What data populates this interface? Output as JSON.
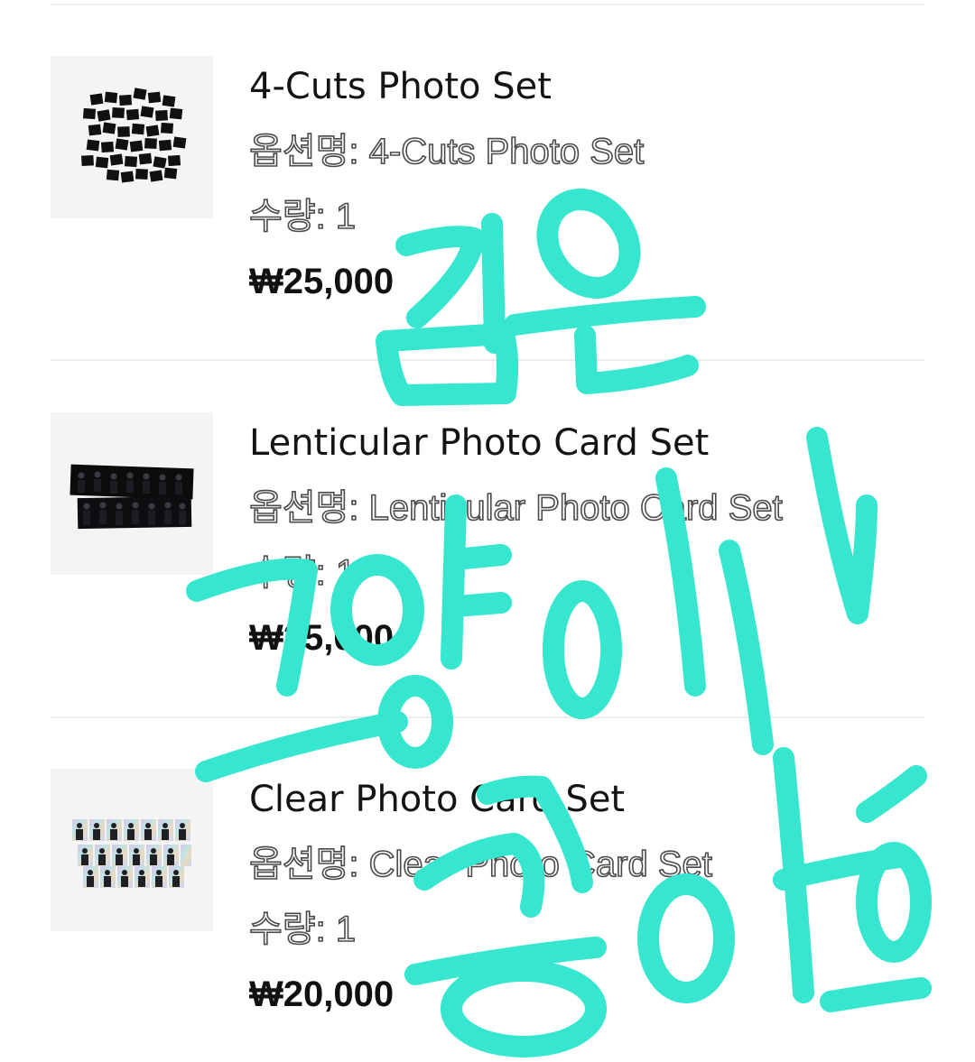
{
  "items": [
    {
      "name": "4-Cuts Photo Set",
      "option_label": "옵션명:",
      "option_value": "4-Cuts Photo Set",
      "qty_label": "수량:",
      "qty_value": "1",
      "price": "₩25,000"
    },
    {
      "name": "Lenticular Photo Card Set",
      "option_label": "옵션명:",
      "option_value": "Lenticular Photo Card Set",
      "qty_label": "수량:",
      "qty_value": "1",
      "price": "₩25,000"
    },
    {
      "name": "Clear Photo Card Set",
      "option_label": "옵션명:",
      "option_value": "Clear Photo Card Set",
      "qty_label": "수량:",
      "qty_value": "1",
      "price": "₩20,000"
    }
  ],
  "handwriting": {
    "text": "김은 고양이가 좋아",
    "color": "#36E6CF"
  }
}
